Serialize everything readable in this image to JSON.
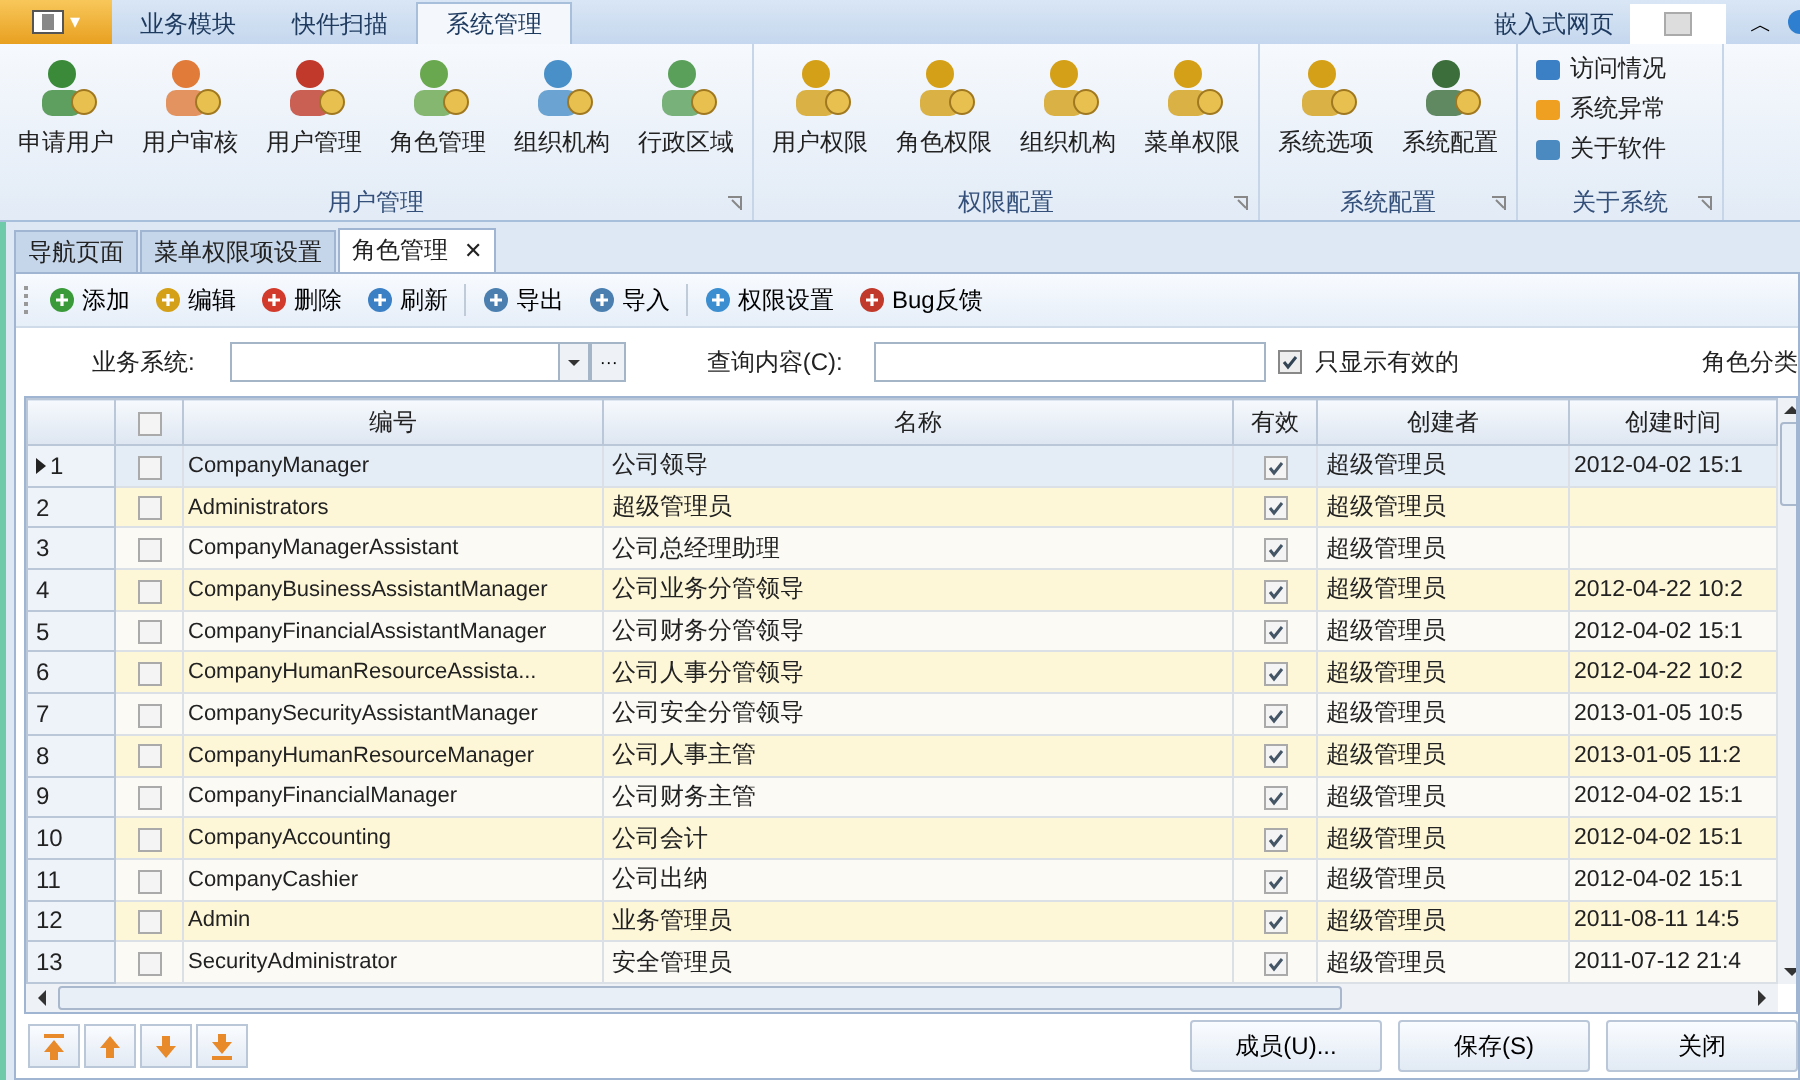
{
  "app_button": {
    "glyph": "▾"
  },
  "ribbon_tabs": [
    {
      "label": "业务模块",
      "selected": false
    },
    {
      "label": "快件扫描",
      "selected": false
    },
    {
      "label": "系统管理",
      "selected": true
    }
  ],
  "title_right": {
    "label": "嵌入式网页",
    "collapse": "︿"
  },
  "ribbon_groups": [
    {
      "title": "用户管理",
      "kind": "large",
      "items": [
        {
          "label": "申请用户"
        },
        {
          "label": "用户审核"
        },
        {
          "label": "用户管理"
        },
        {
          "label": "角色管理"
        },
        {
          "label": "组织机构"
        },
        {
          "label": "行政区域"
        }
      ]
    },
    {
      "title": "权限配置",
      "kind": "large",
      "items": [
        {
          "label": "用户权限"
        },
        {
          "label": "角色权限"
        },
        {
          "label": "组织机构"
        },
        {
          "label": "菜单权限"
        }
      ]
    },
    {
      "title": "系统配置",
      "kind": "large",
      "items": [
        {
          "label": "系统选项"
        },
        {
          "label": "系统配置"
        }
      ]
    },
    {
      "title": "关于系统",
      "kind": "small",
      "items": [
        {
          "label": "访问情况"
        },
        {
          "label": "系统异常"
        },
        {
          "label": "关于软件"
        }
      ]
    }
  ],
  "doc_tabs": [
    {
      "label": "导航页面",
      "selected": false
    },
    {
      "label": "菜单权限项设置",
      "selected": false
    },
    {
      "label": "角色管理",
      "selected": true,
      "close": "✕"
    }
  ],
  "toolbar_groups": [
    [
      "添加",
      "编辑",
      "删除",
      "刷新"
    ],
    [
      "导出",
      "导入"
    ],
    [
      "权限设置",
      "Bug反馈"
    ]
  ],
  "filter": {
    "system_label": "业务系统:",
    "browse": "···",
    "query_label": "查询内容(C):",
    "only_valid": {
      "label": "只显示有效的",
      "checked": true
    },
    "category_label": "角色分类"
  },
  "table": {
    "select_all_checked": false,
    "columns": [
      "编号",
      "名称",
      "有效",
      "创建者",
      "创建时间"
    ],
    "rows": [
      {
        "num": "1",
        "selected": true,
        "checked": false,
        "code": "CompanyManager",
        "name": "公司领导",
        "valid": true,
        "creator": "超级管理员",
        "created": "2012-04-02 15:1"
      },
      {
        "num": "2",
        "selected": false,
        "checked": false,
        "code": "Administrators",
        "name": "超级管理员",
        "valid": true,
        "creator": "超级管理员"
      },
      {
        "num": "3",
        "selected": false,
        "checked": false,
        "code": "CompanyManagerAssistant",
        "name": "公司总经理助理",
        "valid": true,
        "creator": "超级管理员"
      },
      {
        "num": "4",
        "selected": false,
        "checked": false,
        "code": "CompanyBusinessAssistantManager",
        "name": "公司业务分管领导",
        "valid": true,
        "creator": "超级管理员",
        "created": "2012-04-22 10:2"
      },
      {
        "num": "5",
        "selected": false,
        "checked": false,
        "code": "CompanyFinancialAssistantManager",
        "name": "公司财务分管领导",
        "valid": true,
        "creator": "超级管理员",
        "created": "2012-04-02 15:1"
      },
      {
        "num": "6",
        "selected": false,
        "checked": false,
        "code": "CompanyHumanResourceAssista...",
        "name": "公司人事分管领导",
        "valid": true,
        "creator": "超级管理员",
        "created": "2012-04-22 10:2"
      },
      {
        "num": "7",
        "selected": false,
        "checked": false,
        "code": "CompanySecurityAssistantManager",
        "name": "公司安全分管领导",
        "valid": true,
        "creator": "超级管理员",
        "created": "2013-01-05 10:5"
      },
      {
        "num": "8",
        "selected": false,
        "checked": false,
        "code": "CompanyHumanResourceManager",
        "name": "公司人事主管",
        "valid": true,
        "creator": "超级管理员",
        "created": "2013-01-05 11:2"
      },
      {
        "num": "9",
        "selected": false,
        "checked": false,
        "code": "CompanyFinancialManager",
        "name": "公司财务主管",
        "valid": true,
        "creator": "超级管理员",
        "created": "2012-04-02 15:1"
      },
      {
        "num": "10",
        "selected": false,
        "checked": false,
        "code": "CompanyAccounting",
        "name": "公司会计",
        "valid": true,
        "creator": "超级管理员",
        "created": "2012-04-02 15:1"
      },
      {
        "num": "11",
        "selected": false,
        "checked": false,
        "code": "CompanyCashier",
        "name": "公司出纳",
        "valid": true,
        "creator": "超级管理员",
        "created": "2012-04-02 15:1"
      },
      {
        "num": "12",
        "selected": false,
        "checked": false,
        "code": "Admin",
        "name": "业务管理员",
        "valid": true,
        "creator": "超级管理员",
        "created": "2011-08-11 14:5"
      },
      {
        "num": "13",
        "selected": false,
        "checked": false,
        "code": "SecurityAdministrator",
        "name": "安全管理员",
        "valid": true,
        "creator": "超级管理员",
        "created": "2011-07-12 21:4"
      }
    ]
  },
  "buttons": [
    "成员(U)...",
    "保存(S)",
    "关闭"
  ]
}
